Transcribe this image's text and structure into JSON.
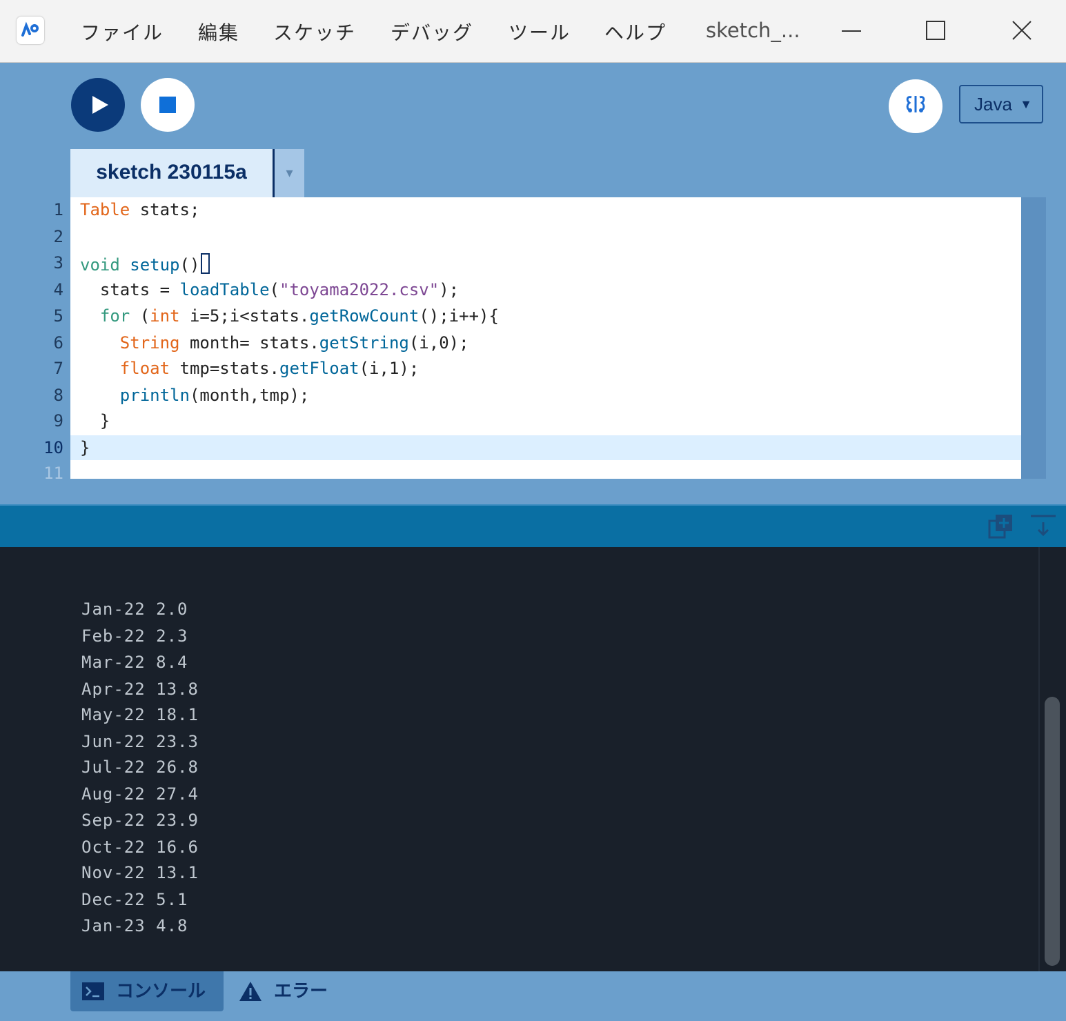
{
  "menu": {
    "items": [
      "ファイル",
      "編集",
      "スケッチ",
      "デバッグ",
      "ツール",
      "ヘルプ"
    ],
    "window_title": "sketch_..."
  },
  "icons": {
    "app": "processing-logo-icon",
    "minimize": "minimize-icon",
    "maximize": "maximize-icon",
    "close": "close-icon",
    "run": "play-icon",
    "stop": "stop-icon",
    "debug": "debugger-butterfly-icon",
    "tab_menu": "chevron-down-icon",
    "console_copy": "copy-add-icon",
    "console_clear": "scroll-to-bottom-icon",
    "console_tab": "terminal-icon",
    "error_tab": "warning-icon"
  },
  "toolbar": {
    "mode": "Java",
    "mode_caret": "▼"
  },
  "tab": {
    "name": "sketch 230115a",
    "menu_glyph": "▾"
  },
  "editor": {
    "line_numbers": [
      "1",
      "2",
      "3",
      "4",
      "5",
      "6",
      "7",
      "8",
      "9",
      "10",
      "11"
    ],
    "active_line": 10,
    "code": [
      "Table stats;",
      "",
      "void setup(){",
      "  stats = loadTable(\"toyama2022.csv\");",
      "  for (int i=5;i<stats.getRowCount();i++){",
      "    String month= stats.getString(i,0);",
      "    float tmp=stats.getFloat(i,1);",
      "    println(month,tmp);",
      "  }",
      "}",
      ""
    ]
  },
  "console": {
    "lines": [
      "Jan-22 2.0",
      "Feb-22 2.3",
      "Mar-22 8.4",
      "Apr-22 13.8",
      "May-22 18.1",
      "Jun-22 23.3",
      "Jul-22 26.8",
      "Aug-22 27.4",
      "Sep-22 23.9",
      "Oct-22 16.6",
      "Nov-22 13.1",
      "Dec-22 5.1",
      "Jan-23 4.8"
    ]
  },
  "footer": {
    "console_label": "コンソール",
    "errors_label": "エラー"
  },
  "colors": {
    "toolbar_bg": "#6b9fcc",
    "run_button": "#0b3a7a",
    "console_bg": "#19202a",
    "console_header": "#0a6fa3",
    "active_line": "#dcefff"
  }
}
